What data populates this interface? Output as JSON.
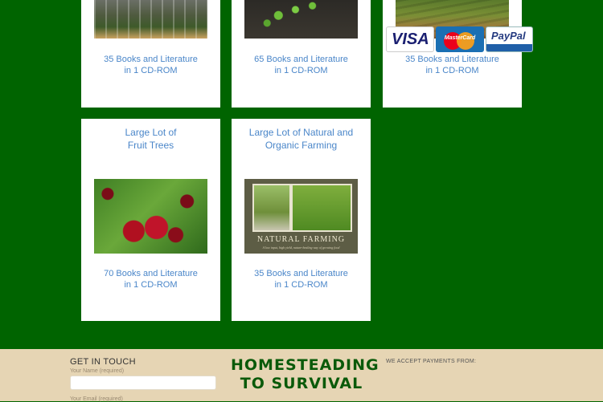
{
  "products": [
    {
      "id": "c1",
      "desc": "35 Books and Literature\nin 1 CD-ROM",
      "image": "greenhouse-photo"
    },
    {
      "id": "c2",
      "desc": "65 Books and Literature\nin 1 CD-ROM",
      "image": "seedlings-soil-photo"
    },
    {
      "id": "c3",
      "desc": "35 Books and Literature\nin 1 CD-ROM",
      "image": "farm-field-photo"
    },
    {
      "id": "c4",
      "title": "Large Lot of\nFruit Trees",
      "desc": "70 Books and Literature\nin 1 CD-ROM",
      "image": "cherries-photo"
    },
    {
      "id": "c5",
      "title": "Large Lot of Natural and\nOrganic Farming",
      "desc": "35 Books and Literature\nin 1 CD-ROM",
      "image": "natural-farming-cover",
      "cover_title": "NATURAL FARMING",
      "cover_subtitle": "A low input, high yield, nature-healing way of growing food"
    }
  ],
  "footer": {
    "get_in_touch": "GET IN TOUCH",
    "name_label": "Your Name (required)",
    "email_label": "Your Email (required)",
    "logo_line1": "HOMESTEADING",
    "logo_line2": "TO SURVIVAL",
    "payments_heading": "WE ACCEPT PAYMENTS FROM:",
    "payment_methods": [
      "VISA",
      "MasterCard",
      "PayPal"
    ]
  },
  "colors": {
    "background": "#006400",
    "link": "#4a86c9",
    "footer_bg": "#e6d5b4",
    "logo": "#0a5a0a"
  }
}
